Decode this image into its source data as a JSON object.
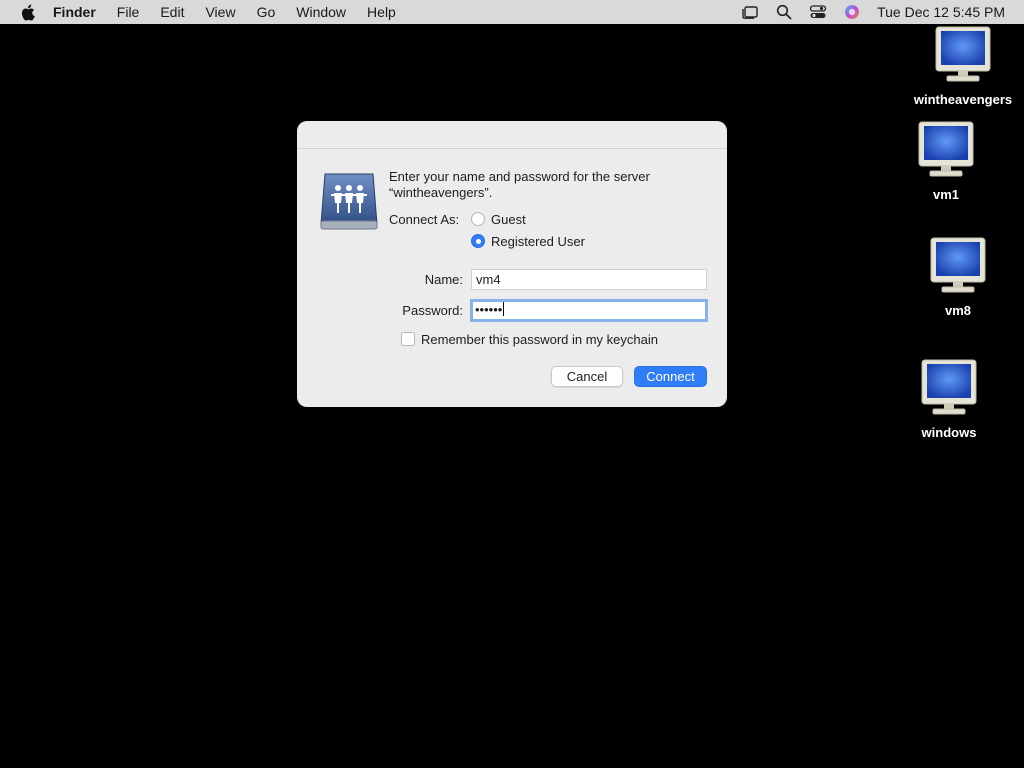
{
  "menubar": {
    "items": [
      "Finder",
      "File",
      "Edit",
      "View",
      "Go",
      "Window",
      "Help"
    ],
    "clock": "Tue Dec 12  5:45 PM",
    "status_icons": [
      "stage-manager-icon",
      "spotlight-search-icon",
      "control-center-icon",
      "siri-icon"
    ]
  },
  "desktop": {
    "icons": [
      {
        "label": "wintheavengers",
        "icon": "monitor-icon"
      },
      {
        "label": "vm1",
        "icon": "monitor-icon"
      },
      {
        "label": "vm8",
        "icon": "monitor-icon"
      },
      {
        "label": "windows",
        "icon": "monitor-icon"
      }
    ]
  },
  "dialog": {
    "prompt": "Enter your name and password for the server “wintheavengers”.",
    "connect_as_label": "Connect As:",
    "options": [
      {
        "label": "Guest",
        "selected": false
      },
      {
        "label": "Registered User",
        "selected": true
      }
    ],
    "name_label": "Name:",
    "name_value": "vm4",
    "password_label": "Password:",
    "password_value": "••••••",
    "remember_label": "Remember this password in my keychain",
    "remember_checked": false,
    "cancel_label": "Cancel",
    "connect_label": "Connect"
  },
  "colors": {
    "accent": "#2f7ef7",
    "desktop": "#000000",
    "menubar": "#d9d9d9"
  }
}
